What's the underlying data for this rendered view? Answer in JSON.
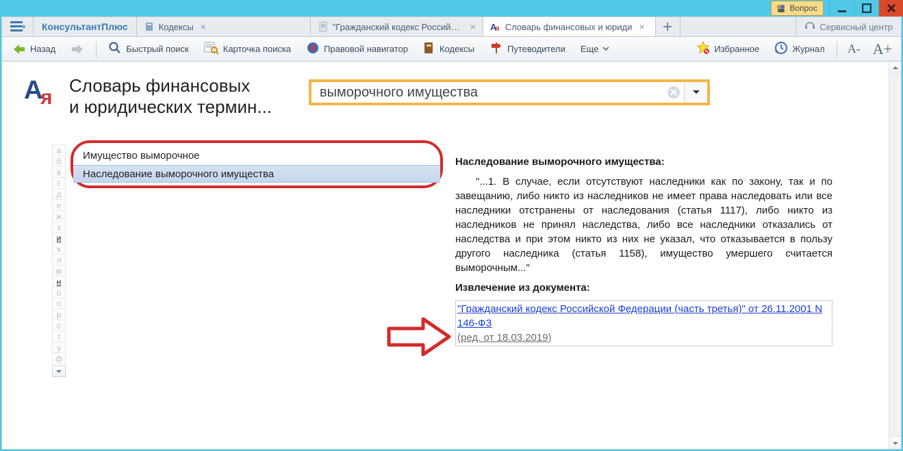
{
  "titlebar": {
    "question_label": "Вопрос",
    "service_center": "Сервисный центр"
  },
  "brand": "КонсультантПлюс",
  "tabs": [
    {
      "label": "Кодексы"
    },
    {
      "label": "\"Гражданский кодекс Российско"
    },
    {
      "label": "Словарь финансовых и юриди"
    }
  ],
  "toolbar": {
    "back": "Назад",
    "quick_search": "Быстрый поиск",
    "card_search": "Карточка поиска",
    "legal_navigator": "Правовой навигатор",
    "codexes": "Кодексы",
    "guides": "Путеводители",
    "more": "Еще",
    "favorites": "Избранное",
    "journal": "Журнал",
    "font_dec": "A-",
    "font_inc": "A+"
  },
  "dict_title_line1": "Словарь финансовых",
  "dict_title_line2": "и юридических термин...",
  "search_value": "выморочного имущества",
  "terms": [
    {
      "label": "Имущество выморочное"
    },
    {
      "label": "Наследование выморочного имущества"
    }
  ],
  "alphabet": [
    {
      "l": "а",
      "on": false
    },
    {
      "l": "б",
      "on": false
    },
    {
      "l": "в",
      "on": false
    },
    {
      "l": "г",
      "on": false
    },
    {
      "l": "д",
      "on": false
    },
    {
      "l": "е",
      "on": false
    },
    {
      "l": "ж",
      "on": false
    },
    {
      "l": "з",
      "on": false
    },
    {
      "l": "и",
      "on": true
    },
    {
      "l": "к",
      "on": false
    },
    {
      "l": "л",
      "on": false
    },
    {
      "l": "м",
      "on": false
    },
    {
      "l": "н",
      "on": true
    },
    {
      "l": "о",
      "on": false
    },
    {
      "l": "п",
      "on": false
    },
    {
      "l": "р",
      "on": false
    },
    {
      "l": "с",
      "on": false
    },
    {
      "l": "т",
      "on": false
    },
    {
      "l": "у",
      "on": false
    },
    {
      "l": "ф",
      "on": false
    }
  ],
  "definition": {
    "heading": "Наследование выморочного имущества:",
    "body": "\"...1. В случае, если отсутствуют наследники как по закону, так и по завещанию, либо никто из наследников не имеет права наследовать или все наследники отстранены от наследования (статья 1117), либо никто из наследников не принял наследства, либо все наследники отказались от наследства и при этом никто из них не указал, что отказывается в пользу другого наследника (статья 1158), имущество умершего считается выморочным...\"",
    "extract_label": "Извлечение из документа:",
    "doc_link": "\"Гражданский кодекс Российской Федерации (часть третья)\" от 26.11.2001 N 146-ФЗ",
    "doc_edition": "(ред. от 18.03.2019)"
  }
}
